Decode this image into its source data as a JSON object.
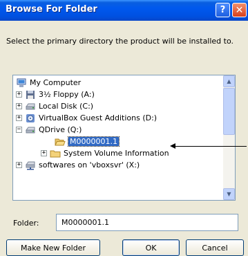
{
  "window": {
    "title": "Browse For Folder",
    "help_glyph": "?",
    "close_glyph": "✕"
  },
  "description": "Select the primary directory the product will be installed to.",
  "tree": {
    "items": [
      {
        "label": "My Computer",
        "icon": "computer-icon",
        "expander": ""
      },
      {
        "label": "3½ Floppy (A:)",
        "icon": "floppy-icon",
        "expander": "+"
      },
      {
        "label": "Local Disk (C:)",
        "icon": "drive-icon",
        "expander": "+"
      },
      {
        "label": "VirtualBox Guest Additions (D:)",
        "icon": "cd-drive-icon",
        "expander": "+"
      },
      {
        "label": "QDrive (Q:)",
        "icon": "drive-icon",
        "expander": "−"
      },
      {
        "label": "M0000001.1",
        "icon": "folder-open-icon",
        "expander": "",
        "selected": true
      },
      {
        "label": "System Volume Information",
        "icon": "folder-icon",
        "expander": "+"
      },
      {
        "label": "softwares on 'vboxsvr' (X:)",
        "icon": "network-drive-icon",
        "expander": "+"
      }
    ]
  },
  "folder_field": {
    "label": "Folder:",
    "value": "M0000001.1"
  },
  "buttons": {
    "make_new_folder": "Make New Folder",
    "ok": "OK",
    "cancel": "Cancel"
  },
  "colors": {
    "titlebar": "#0058ee",
    "selection": "#316ac5",
    "face": "#ece9d8"
  }
}
